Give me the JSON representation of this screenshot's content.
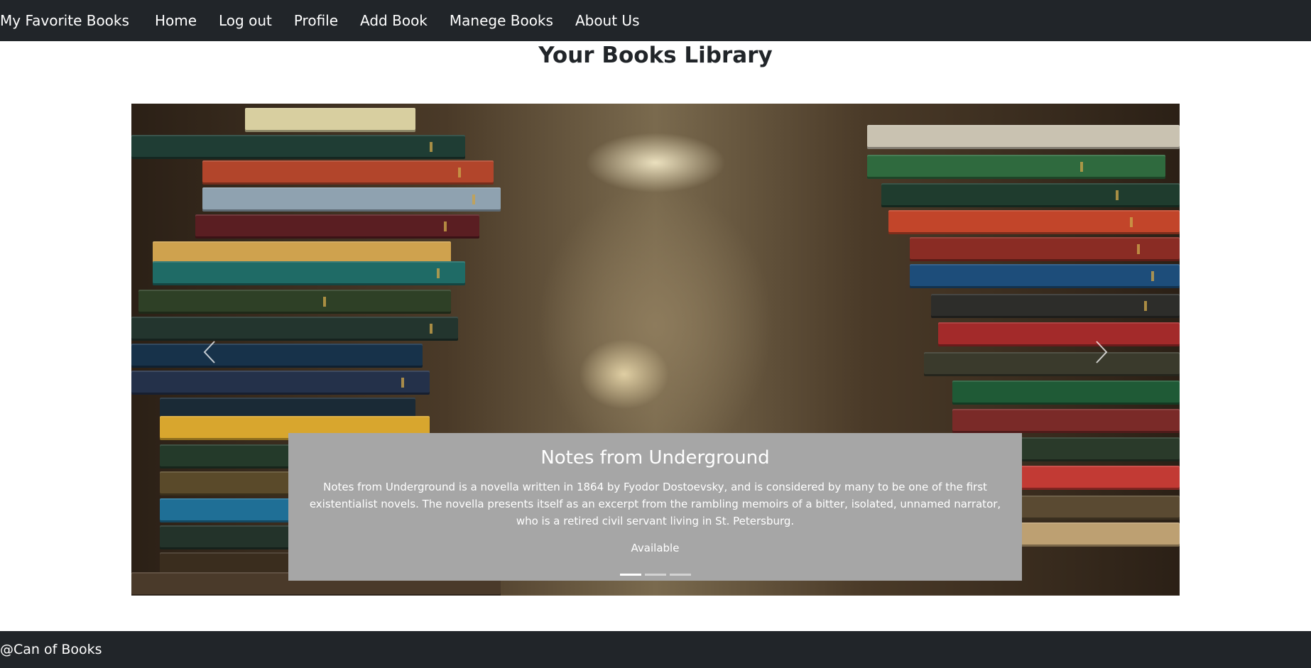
{
  "navbar": {
    "brand": "My Favorite Books",
    "links": [
      {
        "label": "Home"
      },
      {
        "label": "Log out"
      },
      {
        "label": "Profile"
      },
      {
        "label": "Add Book"
      },
      {
        "label": "Manege Books"
      },
      {
        "label": "About Us"
      }
    ],
    "background": "#212529"
  },
  "main": {
    "title": "Your Books Library",
    "carousel": {
      "active_index": 0,
      "slide_count": 3,
      "prev_icon": "chevron-left-icon",
      "next_icon": "chevron-right-icon",
      "caption": {
        "title": "Notes from Underground",
        "description": "Notes from Underground is a novella written in 1864 by Fyodor Dostoevsky, and is considered by many to be one of the first existentialist novels. The novella presents itself as an excerpt from the rambling memoirs of a bitter, isolated, unnamed narrator, who is a retired civil servant living in St. Petersburg.",
        "status": "Available",
        "background": "#a6a6a6"
      }
    }
  },
  "footer": {
    "text": "@Can of Books",
    "background": "#212529"
  }
}
